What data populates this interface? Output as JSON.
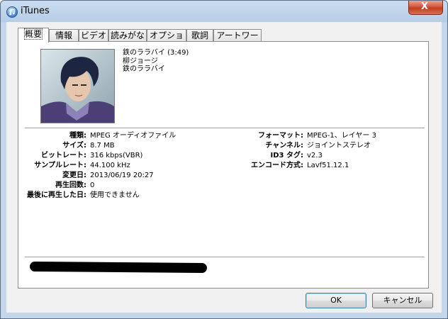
{
  "window": {
    "title": "iTunes",
    "close_label": "X"
  },
  "tabs": [
    {
      "label": "概要",
      "active": true
    },
    {
      "label": "情報"
    },
    {
      "label": "ビデオ"
    },
    {
      "label": "読みがな"
    },
    {
      "label": "オプション"
    },
    {
      "label": "歌詞"
    },
    {
      "label": "アートワーク"
    }
  ],
  "track": {
    "title_line": "鉄のララバイ (3:49)",
    "artist": "柳ジョージ",
    "album": "鉄のララバイ"
  },
  "details_left": [
    {
      "label": "種類:",
      "value": "MPEG オーディオファイル"
    },
    {
      "label": "サイズ:",
      "value": "8.7 MB"
    },
    {
      "label": "ビットレート:",
      "value": "316 kbps(VBR)"
    },
    {
      "label": "サンプルレート:",
      "value": "44.100 kHz"
    },
    {
      "label": "変更日:",
      "value": "2013/06/19 20:27"
    },
    {
      "label": "再生回数:",
      "value": "0"
    },
    {
      "label": "最後に再生した日:",
      "value": "使用できません"
    }
  ],
  "details_right": [
    {
      "label": "フォーマット:",
      "value": "MPEG-1、レイヤー 3"
    },
    {
      "label": "チャンネル:",
      "value": "ジョイントステレオ"
    },
    {
      "label": "ID3 タグ:",
      "value": "v2.3"
    },
    {
      "label": "エンコード方式:",
      "value": "Lavf51.12.1"
    }
  ],
  "buttons": {
    "ok": "OK",
    "cancel": "キャンセル"
  }
}
